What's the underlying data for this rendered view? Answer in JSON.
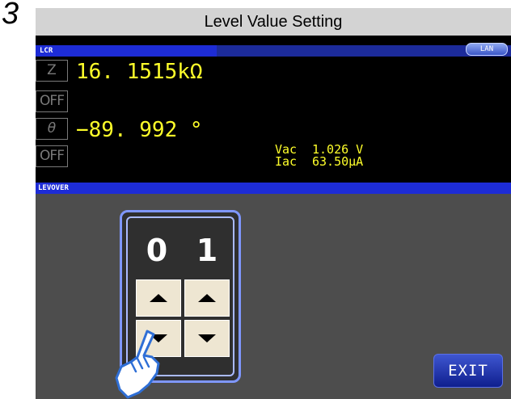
{
  "step_number": "3",
  "title": "Level Value Setting",
  "header": {
    "tab_label": "LCR",
    "lan_badge": "LAN"
  },
  "params": [
    {
      "symbol": "Z",
      "value": "16. 1515kΩ"
    },
    {
      "symbol": "OFF"
    },
    {
      "symbol": "θ",
      "value": "−89. 992 °"
    },
    {
      "symbol": "OFF"
    }
  ],
  "monitor": {
    "vac_label": "Vac",
    "vac_value": "1.026 V",
    "iac_label": "Iac",
    "iac_value": "63.50μA"
  },
  "section_title": "LEVOVER",
  "spinner": {
    "digits": [
      "0",
      "1"
    ]
  },
  "exit_label": "EXIT",
  "colors": {
    "value_text": "#ffff2a",
    "tab_blue": "#1d2cd6",
    "lower_panel": "#4d4d4d",
    "spinner_border": "#7f97ff",
    "arrow_button": "#eee6d2"
  }
}
